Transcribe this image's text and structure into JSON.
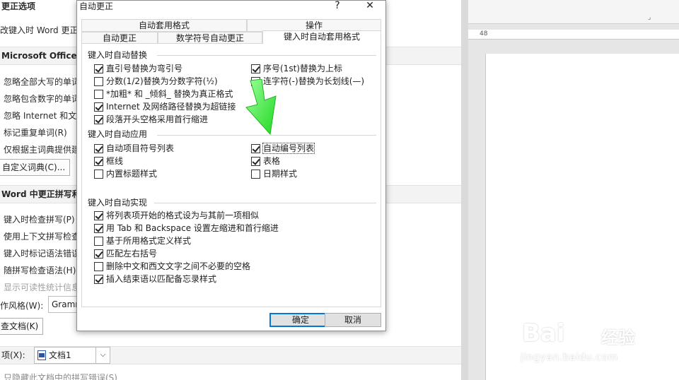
{
  "background_window": {
    "header_title": "更正选项",
    "line_word_correct": "改键入时 Word 更正",
    "section_office": "Microsoft Office 程",
    "office_items": [
      "忽略全部大写的单词",
      "忽略包含数字的单词",
      "忽略 Internet 和文",
      "标记重复单词(R)",
      "仅根据主词典提供建"
    ],
    "custom_dict_button": "自定义词典(C)...",
    "section_word": "Word 中更正拼写和语",
    "word_items": [
      "键入时检查拼写(P)",
      "使用上下文拼写检查",
      "键入时标记语法错误",
      "随拼写检查语法(H)",
      "显示可读性统计信息"
    ],
    "writing_style_label": "作风格(W):",
    "writing_style_value": "Gramm",
    "check_doc_button": "查文档(K)",
    "exceptions_label": "项(X):",
    "exceptions_value": "文档1",
    "bottom_hint": "只隐藏此文档中的拼写错误(S)"
  },
  "document_area": {
    "ruler_number": "48"
  },
  "watermark": {
    "brand": "Bai",
    "brand_suffix": "经验",
    "url": "jingyan.baidu.com"
  },
  "dialog": {
    "title": "自动更正",
    "help_glyph": "?",
    "close_glyph": "✕",
    "tabs_row1": [
      "自动套用格式",
      "操作"
    ],
    "tabs_row2": [
      "自动更正",
      "数学符号自动更正",
      "键入时自动套用格式"
    ],
    "active_tab": "键入时自动套用格式",
    "groups": {
      "replace": {
        "label": "键入时自动替换",
        "left": [
          {
            "label": "直引号替换为弯引号",
            "checked": true
          },
          {
            "label": "分数(1/2)替换为分数字符(½)",
            "checked": false
          },
          {
            "label": "*加粗* 和 _倾斜_ 替换为真正格式",
            "checked": false
          },
          {
            "label": "Internet 及网络路径替换为超链接",
            "checked": true
          },
          {
            "label": "段落开头空格采用首行缩进",
            "checked": true
          }
        ],
        "right": [
          {
            "label": "序号(1st)替换为上标",
            "checked": true
          },
          {
            "label": "连字符(-)替换为长划线(—)",
            "checked": true
          }
        ]
      },
      "apply": {
        "label": "键入时自动应用",
        "left": [
          {
            "label": "自动项目符号列表",
            "checked": true
          },
          {
            "label": "框线",
            "checked": true
          },
          {
            "label": "内置标题样式",
            "checked": false
          }
        ],
        "right": [
          {
            "label": "自动编号列表",
            "checked": true
          },
          {
            "label": "表格",
            "checked": true
          },
          {
            "label": "日期样式",
            "checked": false
          }
        ]
      },
      "auto": {
        "label": "键入时自动实现",
        "items": [
          {
            "label": "将列表项开始的格式设为与其前一项相似",
            "checked": true
          },
          {
            "label": "用 Tab 和 Backspace 设置左缩进和首行缩进",
            "checked": true
          },
          {
            "label": "基于所用格式定义样式",
            "checked": false
          },
          {
            "label": "匹配左右括号",
            "checked": true
          },
          {
            "label": "删除中文和西文文字之间不必要的空格",
            "checked": false
          },
          {
            "label": "插入结束语以匹配备忘录样式",
            "checked": true
          }
        ]
      }
    },
    "ok_button": "确定",
    "cancel_button": "取消"
  },
  "colors": {
    "arrow": "#3cf23c",
    "default_button_border": "#0078d7"
  }
}
